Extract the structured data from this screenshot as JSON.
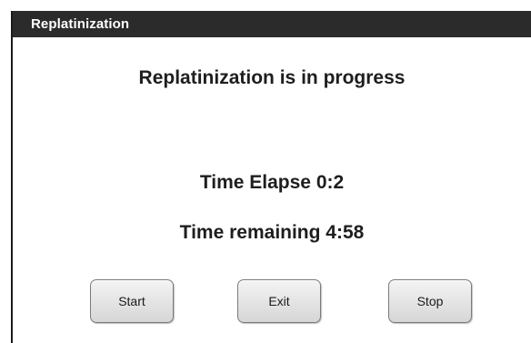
{
  "window": {
    "title": "Replatinization"
  },
  "main": {
    "status_message": "Replatinization is in progress",
    "time_elapsed": "Time Elapse 0:2",
    "time_remaining": "Time remaining 4:58"
  },
  "buttons": {
    "start_label": "Start",
    "exit_label": "Exit",
    "stop_label": "Stop"
  },
  "colors": {
    "title_bar": "#2b2b2b",
    "title_text": "#ffffff",
    "button_face": "#e2e2e2"
  }
}
